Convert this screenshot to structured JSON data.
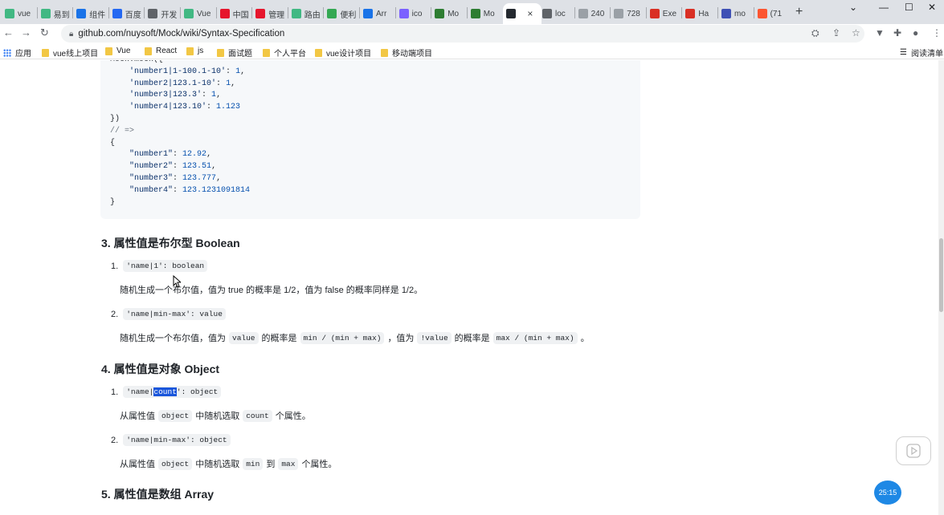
{
  "browser": {
    "tabs": [
      {
        "label": "vue",
        "icon": "vue-icon",
        "color": "#41b883"
      },
      {
        "label": "易到",
        "icon": "vue-icon",
        "color": "#41b883"
      },
      {
        "label": "组件",
        "icon": "edge-icon",
        "color": "#1a73e8"
      },
      {
        "label": "百度",
        "icon": "baidu-icon",
        "color": "#2468f2"
      },
      {
        "label": "开发",
        "icon": "globe-icon",
        "color": "#5f6368"
      },
      {
        "label": "Vue",
        "icon": "vue-icon",
        "color": "#41b883"
      },
      {
        "label": "中国",
        "icon": "weibo-icon",
        "color": "#e6162d"
      },
      {
        "label": "管理",
        "icon": "weibo-icon",
        "color": "#e6162d"
      },
      {
        "label": "路由",
        "icon": "vue-icon",
        "color": "#41b883"
      },
      {
        "label": "便利",
        "icon": "leaf-icon",
        "color": "#34a853"
      },
      {
        "label": "Arr",
        "icon": "j-icon",
        "color": "#1a73e8"
      },
      {
        "label": "ico",
        "icon": "iconfont-icon",
        "color": "#7b61ff"
      },
      {
        "label": "Mo",
        "icon": "mock-icon",
        "color": "#2e7d32"
      },
      {
        "label": "Mo",
        "icon": "mock-icon",
        "color": "#2e7d32"
      },
      {
        "label": "",
        "icon": "github-icon",
        "color": "#24292f",
        "active": true
      },
      {
        "label": "loc",
        "icon": "globe-icon",
        "color": "#5f6368"
      },
      {
        "label": "240",
        "icon": "x-icon",
        "color": "#9aa0a6"
      },
      {
        "label": "728",
        "icon": "x-icon",
        "color": "#9aa0a6"
      },
      {
        "label": "Exe",
        "icon": "opera-icon",
        "color": "#d93025"
      },
      {
        "label": "Ha",
        "icon": "opera-icon",
        "color": "#d93025"
      },
      {
        "label": "mo",
        "icon": "gear-icon",
        "color": "#3f51b5"
      },
      {
        "label": "(71",
        "icon": "csdn-icon",
        "color": "#fc5531"
      }
    ],
    "new_tab_label": "+",
    "window_controls": [
      "⌄",
      "—",
      "☐",
      "✕"
    ],
    "address": "github.com/nuysoft/Mock/wiki/Syntax-Specification",
    "bookmarks": [
      {
        "label": "应用",
        "type": "apps"
      },
      {
        "label": "vue线上项目",
        "type": "folder"
      },
      {
        "label": "Vue",
        "type": "folder"
      },
      {
        "label": "React",
        "type": "folder"
      },
      {
        "label": "js",
        "type": "folder"
      },
      {
        "label": "面试题",
        "type": "folder"
      },
      {
        "label": "个人平台",
        "type": "folder"
      },
      {
        "label": "vue设计项目",
        "type": "folder"
      },
      {
        "label": "移动端项目",
        "type": "folder"
      }
    ],
    "reading_list": "阅读清单"
  },
  "code_block": {
    "lines": [
      {
        "text": "Mock.mock({",
        "cls": ""
      },
      {
        "text": "    'number1|1-100.1-10': 1,",
        "cls": "mix"
      },
      {
        "text": "    'number2|123.1-10': 1,",
        "cls": "mix"
      },
      {
        "text": "    'number3|123.3': 1,",
        "cls": "mix"
      },
      {
        "text": "    'number4|123.10': 1.123",
        "cls": "mix"
      },
      {
        "text": "})",
        "cls": ""
      },
      {
        "text": "// =>",
        "cls": "com"
      },
      {
        "text": "{",
        "cls": ""
      },
      {
        "text": "    \"number1\": 12.92,",
        "cls": "mix"
      },
      {
        "text": "    \"number2\": 123.51,",
        "cls": "mix"
      },
      {
        "text": "    \"number3\": 123.777,",
        "cls": "mix"
      },
      {
        "text": "    \"number4\": 123.1231091814",
        "cls": "mix"
      },
      {
        "text": "}",
        "cls": ""
      }
    ]
  },
  "sections": {
    "boolean": {
      "title": "3. 属性值是布尔型 Boolean",
      "item1_num": "1.",
      "item1_code": "'name|1': boolean",
      "item1_desc": "随机生成一个布尔值，值为 true 的概率是 1/2，值为 false 的概率同样是 1/2。",
      "item2_num": "2.",
      "item2_code": "'name|min-max': value",
      "item2_desc_a": "随机生成一个布尔值，值为",
      "item2_desc_code1": "value",
      "item2_desc_b": "的概率是",
      "item2_desc_code2": "min / (min + max)",
      "item2_desc_c": "，值为",
      "item2_desc_code3": "!value",
      "item2_desc_d": "的概率是",
      "item2_desc_code4": "max / (min + max)",
      "item2_desc_e": "。"
    },
    "object": {
      "title": "4. 属性值是对象 Object",
      "item1_num": "1.",
      "item1_code_a": "'name|",
      "item1_code_hl": "count",
      "item1_code_b": "': object",
      "item1_desc_a": "从属性值",
      "item1_desc_code1": "object",
      "item1_desc_b": "中随机选取",
      "item1_desc_code2": "count",
      "item1_desc_c": "个属性。",
      "item2_num": "2.",
      "item2_code": "'name|min-max': object",
      "item2_desc_a": "从属性值",
      "item2_desc_code1": "object",
      "item2_desc_b": "中随机选取",
      "item2_desc_code2": "min",
      "item2_desc_c": "到",
      "item2_desc_code3": "max",
      "item2_desc_d": "个属性。"
    },
    "array": {
      "title": "5. 属性值是数组 Array"
    }
  },
  "overlay": {
    "timer": "25:15"
  }
}
